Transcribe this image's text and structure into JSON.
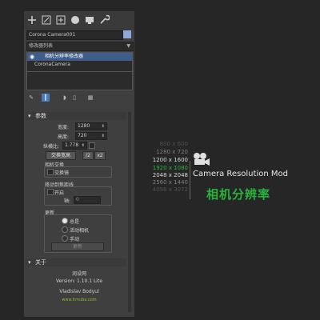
{
  "object": {
    "name": "Corona Camera001",
    "color": "#8fa8d6"
  },
  "modifier_list": {
    "label": "修改器列表"
  },
  "stack": [
    {
      "label": "相机分辨率修改器"
    },
    {
      "label": "CoronaCamera"
    }
  ],
  "params": {
    "title": "参数",
    "width_label": "宽度:",
    "width_value": "1280",
    "height_label": "高度:",
    "height_value": "720",
    "aspect_label": "纵横比:",
    "aspect_value": "1.778",
    "swap_button": "交换宽高",
    "btn_slash": "/2",
    "btn_x2": "x2",
    "camera_swap_group": "相机交换",
    "camera_swap_check": "交换镜",
    "shift_group": "移动到焦距线",
    "shift_on": "开启",
    "shift_axis_label": "轴:",
    "shift_axis_value": "0",
    "update_group": "更新",
    "radio_always": "总是",
    "radio_active": "活动相机",
    "radio_manual": "手动",
    "update_button": "更新"
  },
  "about": {
    "title": "关于",
    "site": "润设网",
    "version": "Version: 1.10.1 Lite",
    "author": "Vladislav Bodyul",
    "url": "www.itmuba.com"
  },
  "promo": {
    "resolutions": [
      "800 x 600",
      "1280 x 720",
      "1200 x 1600",
      "1920 x 1080",
      "2048 x 2048",
      "2560 x 1440",
      "4096 x 3072"
    ],
    "highlight_index": 3,
    "title": "Camera Resolution Mod",
    "subtitle": "相机分辨率",
    "highlight_color": "#27b33a",
    "dim_color": "#9a9a9a"
  }
}
